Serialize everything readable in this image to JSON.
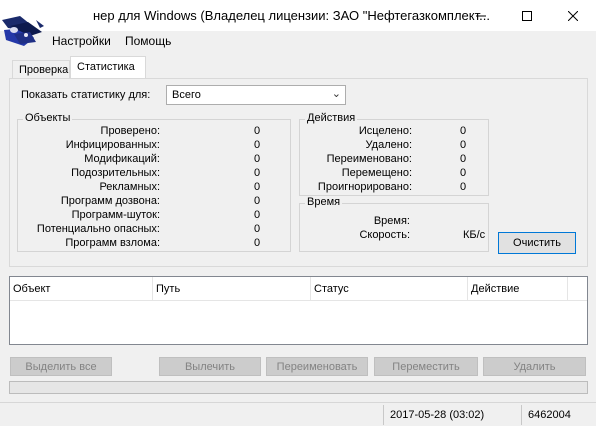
{
  "window": {
    "title": "нер для Windows (Владелец лицензии: ЗАО \"Нефтегазкомплект..."
  },
  "menu": {
    "settings": "Настройки",
    "help": "Помощь"
  },
  "tabs": {
    "check": "Проверка",
    "statistics": "Статистика"
  },
  "filter": {
    "label": "Показать статистику для:",
    "value": "Всего"
  },
  "objects": {
    "legend": "Объекты",
    "rows": [
      {
        "label": "Проверено:",
        "value": "0"
      },
      {
        "label": "Инфицированных:",
        "value": "0"
      },
      {
        "label": "Модификаций:",
        "value": "0"
      },
      {
        "label": "Подозрительных:",
        "value": "0"
      },
      {
        "label": "Рекламных:",
        "value": "0"
      },
      {
        "label": "Программ дозвона:",
        "value": "0"
      },
      {
        "label": "Программ-шуток:",
        "value": "0"
      },
      {
        "label": "Потенциально опасных:",
        "value": "0"
      },
      {
        "label": "Программ взлома:",
        "value": "0"
      }
    ]
  },
  "actions": {
    "legend": "Действия",
    "rows": [
      {
        "label": "Исцелено:",
        "value": "0"
      },
      {
        "label": "Удалено:",
        "value": "0"
      },
      {
        "label": "Переименовано:",
        "value": "0"
      },
      {
        "label": "Перемещено:",
        "value": "0"
      },
      {
        "label": "Проигнорировано:",
        "value": "0"
      }
    ]
  },
  "time": {
    "legend": "Время",
    "time_label": "Время:",
    "time_value": "",
    "speed_label": "Скорость:",
    "speed_value": "КБ/с"
  },
  "clear_button": "Очистить",
  "table": {
    "columns": [
      "Объект",
      "Путь",
      "Статус",
      "Действие"
    ]
  },
  "buttons": {
    "select_all": "Выделить все",
    "cure": "Вылечить",
    "rename": "Переименовать",
    "move": "Переместить",
    "delete": "Удалить"
  },
  "status": {
    "date": "2017-05-28 (03:02)",
    "records": "6462004"
  }
}
